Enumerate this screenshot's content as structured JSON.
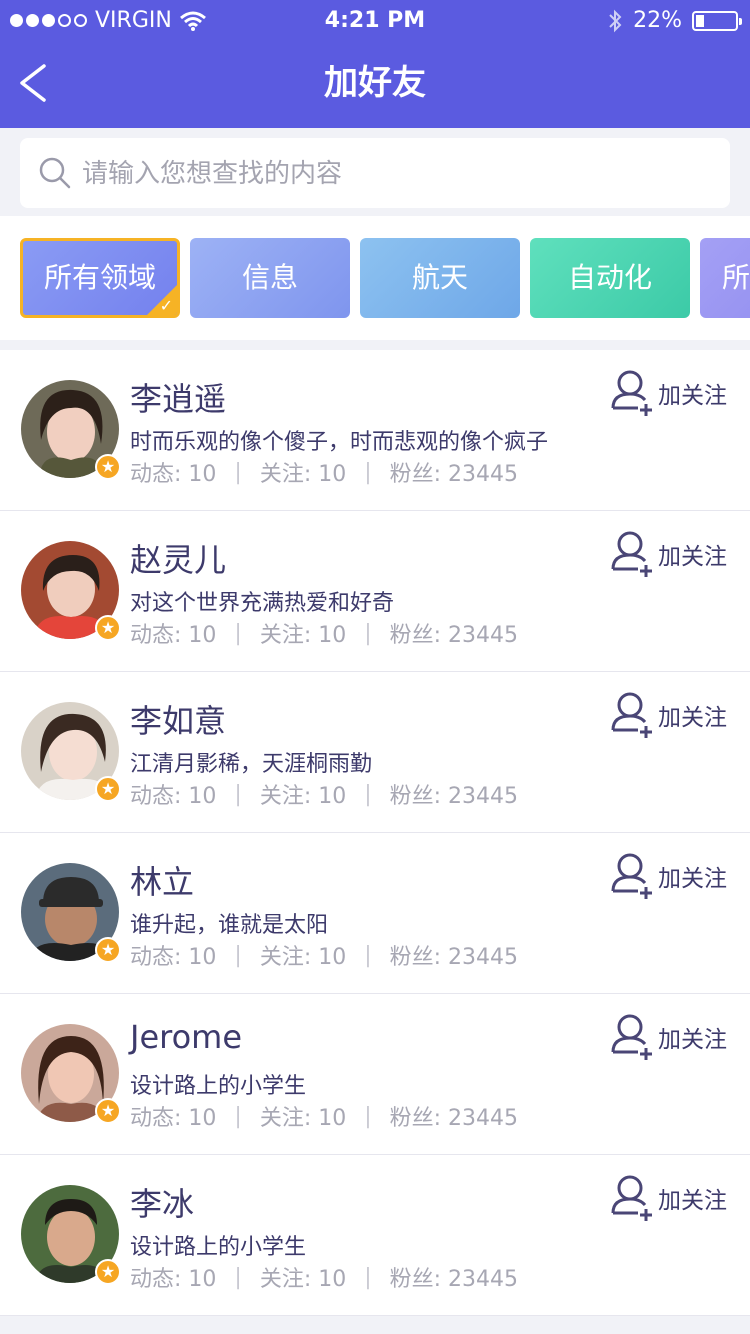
{
  "status_bar": {
    "carrier": "VIRGIN",
    "time": "4:21 PM",
    "battery": "22%",
    "battery_level": 0.22
  },
  "nav": {
    "title": "加好友",
    "back_icon": "chevron-left-icon"
  },
  "search": {
    "placeholder": "请输入您想查找的内容",
    "icon": "search-icon"
  },
  "categories": [
    {
      "label": "所有领域",
      "selected": true,
      "color": "#7f8ff0"
    },
    {
      "label": "信息",
      "selected": false,
      "color": "#8ea2f0"
    },
    {
      "label": "航天",
      "selected": false,
      "color": "#7fb5ec"
    },
    {
      "label": "自动化",
      "selected": false,
      "color": "#49d6b2"
    },
    {
      "label": "所",
      "selected": false,
      "color": "#9a96f2"
    }
  ],
  "users": [
    {
      "name": "李逍遥",
      "bio": "时而乐观的像个傻子，时而悲观的像个疯子",
      "posts_label": "动态: 10",
      "following_label": "关注: 10",
      "fans_label": "粉丝: 23445",
      "follow_label": "加关注"
    },
    {
      "name": "赵灵儿",
      "bio": "对这个世界充满热爱和好奇",
      "posts_label": "动态: 10",
      "following_label": "关注: 10",
      "fans_label": "粉丝: 23445",
      "follow_label": "加关注"
    },
    {
      "name": "李如意",
      "bio": "江清月影稀，天涯桐雨勤",
      "posts_label": "动态: 10",
      "following_label": "关注: 10",
      "fans_label": "粉丝: 23445",
      "follow_label": "加关注"
    },
    {
      "name": "林立",
      "bio": "谁升起，谁就是太阳",
      "posts_label": "动态: 10",
      "following_label": "关注: 10",
      "fans_label": "粉丝: 23445",
      "follow_label": "加关注"
    },
    {
      "name": "Jerome",
      "bio": "设计路上的小学生",
      "posts_label": "动态: 10",
      "following_label": "关注: 10",
      "fans_label": "粉丝: 23445",
      "follow_label": "加关注"
    },
    {
      "name": "李冰",
      "bio": "设计路上的小学生",
      "posts_label": "动态: 10",
      "following_label": "关注: 10",
      "fans_label": "粉丝: 23445",
      "follow_label": "加关注"
    }
  ],
  "colors": {
    "accent": "#5b5be0",
    "text": "#3d3a6b",
    "muted": "#a7a7b3",
    "badge": "#f6a623",
    "selected_border": "#f6b325"
  }
}
